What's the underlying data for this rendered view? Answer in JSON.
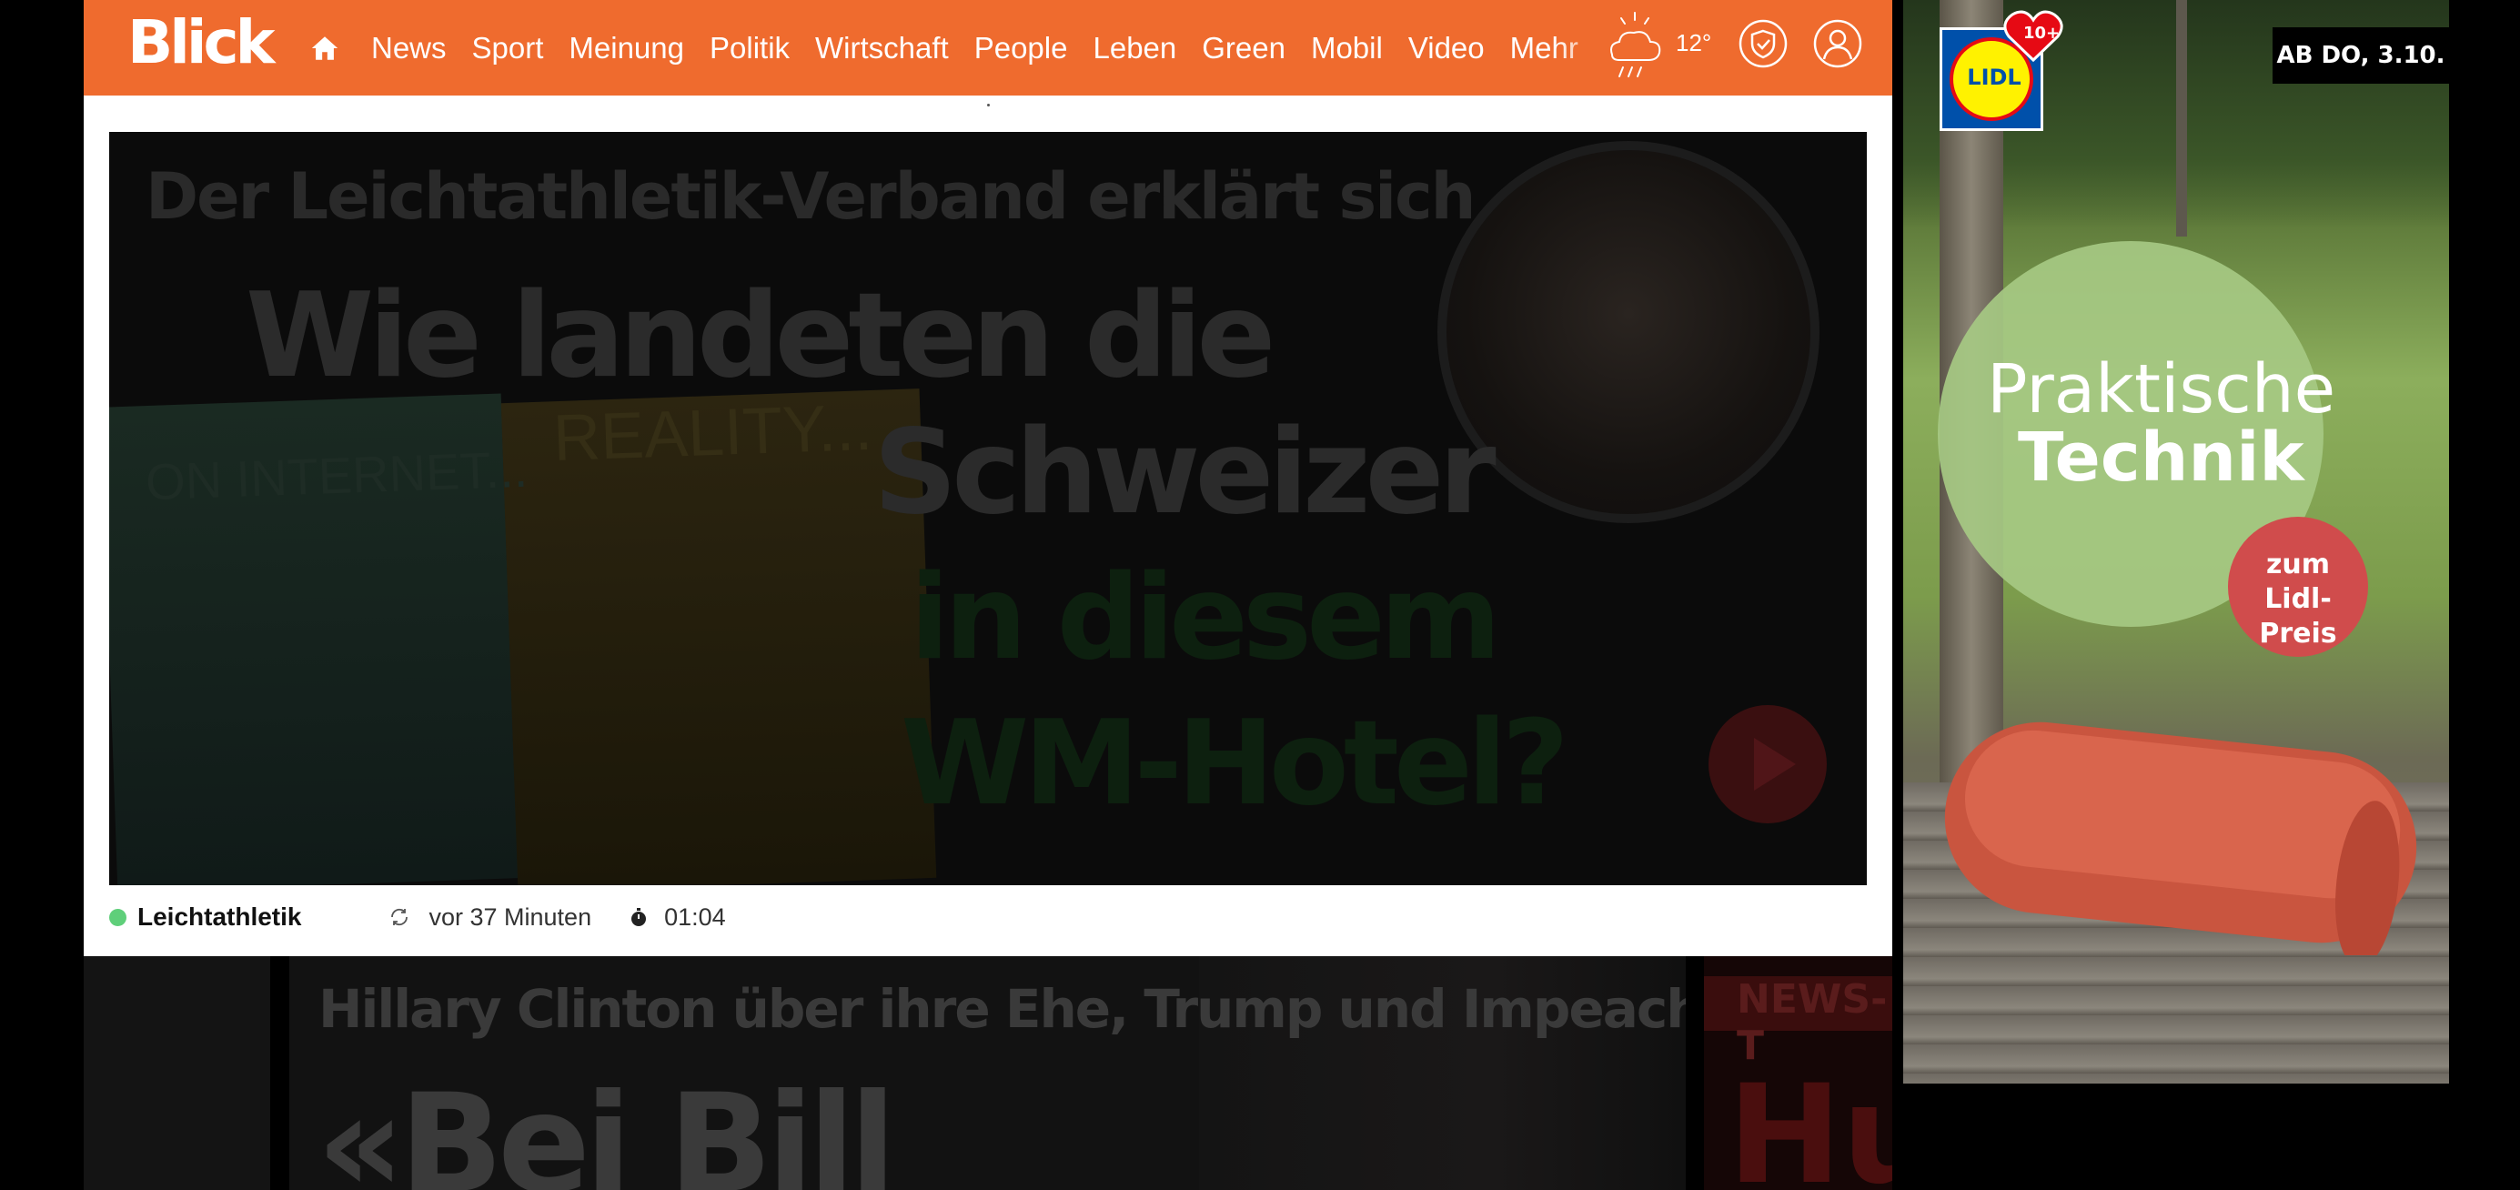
{
  "header": {
    "logo": "Blick",
    "nav": [
      "News",
      "Sport",
      "Meinung",
      "Politik",
      "Wirtschaft",
      "People",
      "Leben",
      "Green",
      "Mobil",
      "Video",
      "Mehr"
    ],
    "weather": {
      "temperature": "12°",
      "icon": "cloud-rain-sun-icon"
    },
    "icons": [
      "home-icon",
      "shield-check-icon",
      "user-icon"
    ],
    "accent": "#ef6b2e"
  },
  "video": {
    "kicker": "Der Leichtathletik-Verband erklärt sich",
    "headline": [
      "Wie landeten die",
      "Schweizer",
      "in diesem",
      "WM-Hotel?"
    ],
    "overlay_left": "ON INTERNET...",
    "overlay_mid": "REALITY...",
    "category": "Leichtathletik",
    "updated": "vor 37 Minuten",
    "duration": "01:04"
  },
  "teasers": {
    "main_kicker": "Hillary Clinton über ihre Ehe, Trump und Impeachments",
    "main_headline": "«Bei Bill",
    "right_tag": "NEWS-T",
    "right_headline": "Hu"
  },
  "ad": {
    "brand": "LIDL",
    "badge": "10+",
    "date": "AB DO, 3.10.",
    "title_1": "Praktische",
    "title_2": "Technik",
    "price_line_1": "zum",
    "price_line_2": "Lidl-Preis"
  }
}
